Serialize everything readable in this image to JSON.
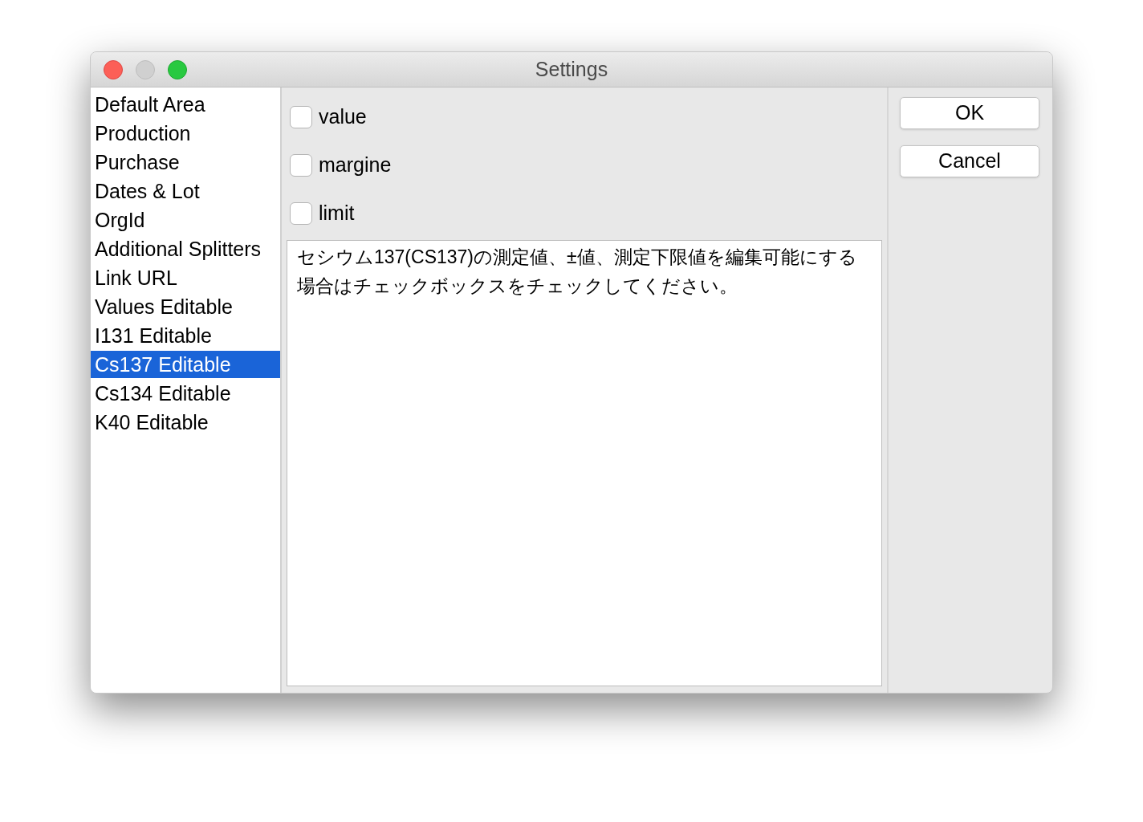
{
  "window": {
    "title": "Settings"
  },
  "sidebar": {
    "items": [
      {
        "label": "Default Area",
        "selected": false
      },
      {
        "label": "Production",
        "selected": false
      },
      {
        "label": "Purchase",
        "selected": false
      },
      {
        "label": "Dates & Lot",
        "selected": false
      },
      {
        "label": "OrgId",
        "selected": false
      },
      {
        "label": "Additional Splitters",
        "selected": false
      },
      {
        "label": "Link URL",
        "selected": false
      },
      {
        "label": "Values Editable",
        "selected": false
      },
      {
        "label": "I131 Editable",
        "selected": false
      },
      {
        "label": "Cs137 Editable",
        "selected": true
      },
      {
        "label": "Cs134 Editable",
        "selected": false
      },
      {
        "label": "K40 Editable",
        "selected": false
      }
    ]
  },
  "options": [
    {
      "label": "value",
      "checked": false
    },
    {
      "label": "margine",
      "checked": false
    },
    {
      "label": "limit",
      "checked": false
    }
  ],
  "description": "セシウム137(CS137)の測定値、±値、測定下限値を編集可能にする場合はチェックボックスをチェックしてください。",
  "buttons": [
    "OK",
    "Cancel"
  ]
}
